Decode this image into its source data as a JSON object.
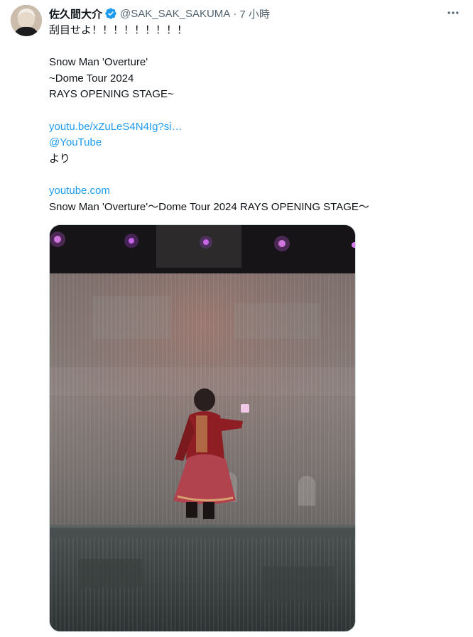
{
  "author": {
    "display_name": "佐久間大介",
    "handle": "@SAK_SAK_SAKUMA",
    "separator": "·",
    "time": "7 小時"
  },
  "tweet": {
    "lines": [
      "刮目せよ！！！！！！！！！",
      "",
      "Snow Man 'Overture'",
      "~Dome Tour 2024",
      "RAYS OPENING STAGE~",
      "",
      "youtu.be/xZuLeS4N4Ig?si…",
      "@YouTube",
      "より",
      "",
      "youtube.com",
      "Snow Man 'Overture'〜Dome Tour 2024 RAYS OPENING STAGE〜"
    ]
  },
  "icons": {
    "verified": "verified-badge-icon",
    "more": "more-icon"
  },
  "colors": {
    "link": "#1d9bf0",
    "secondary_text": "#536471",
    "verified": "#1d9bf0"
  }
}
